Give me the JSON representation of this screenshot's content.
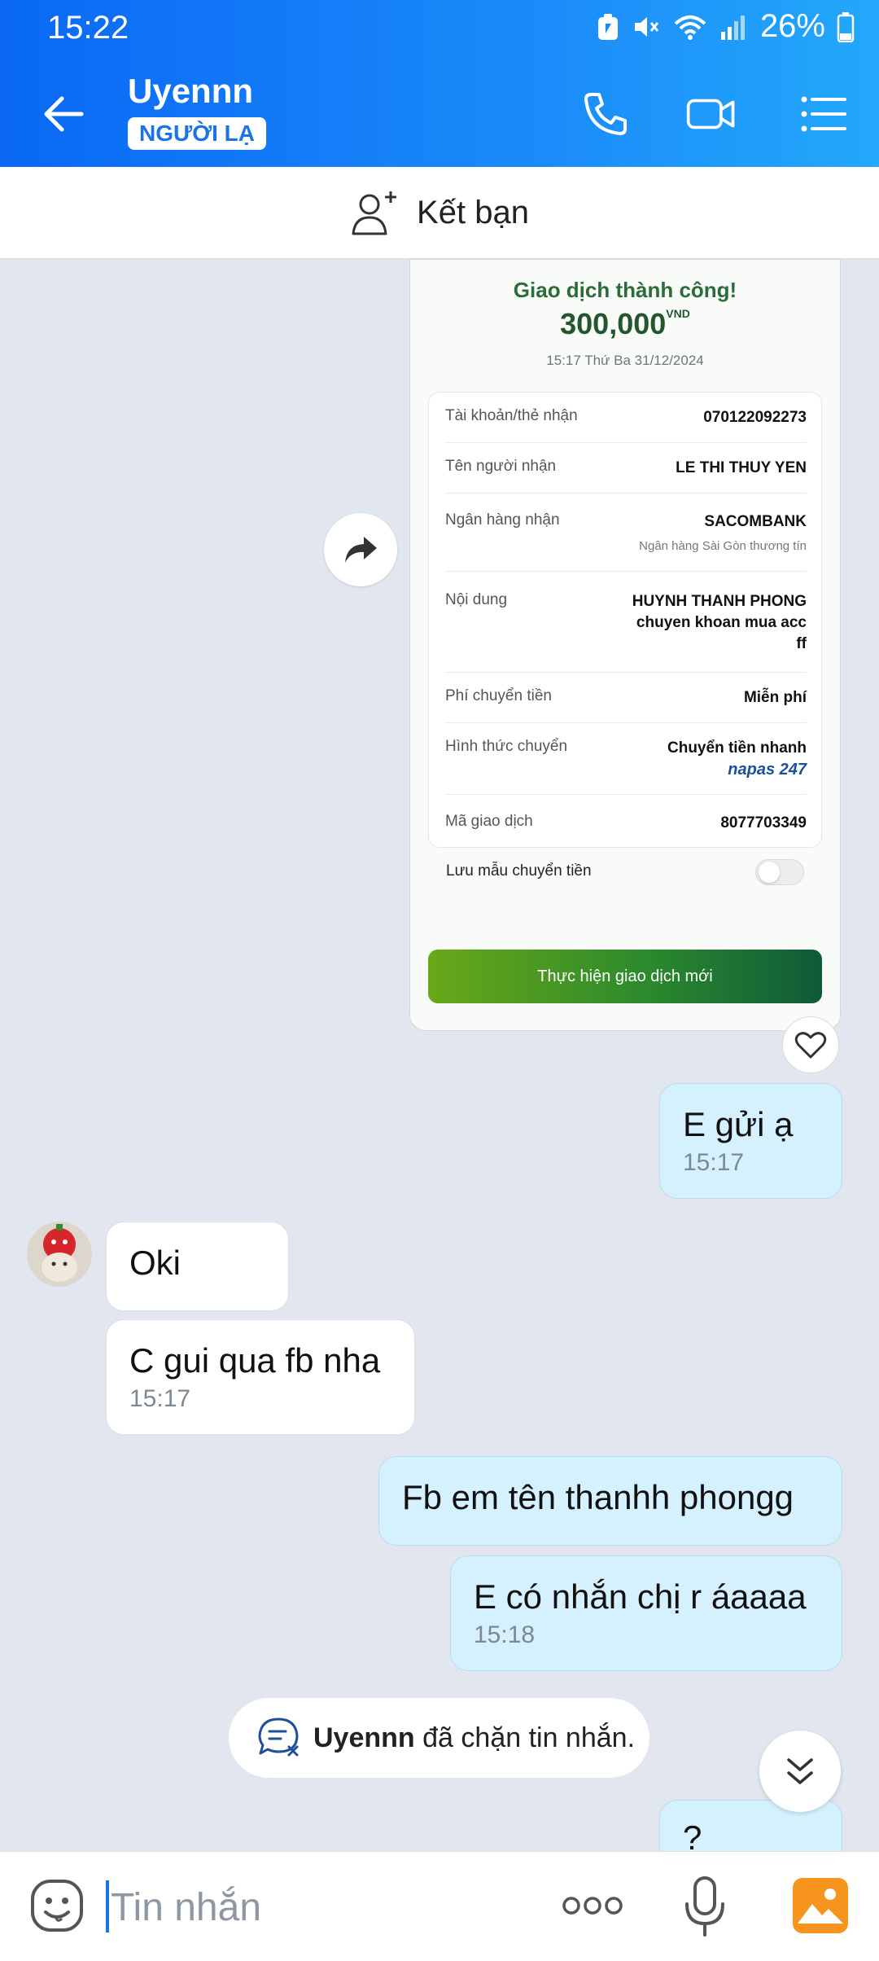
{
  "status_bar": {
    "time": "15:22",
    "battery": "26%"
  },
  "header": {
    "contact_name": "Uyennn",
    "stranger_badge": "NGƯỜI LẠ"
  },
  "friend_bar": {
    "label": "Kết bạn"
  },
  "receipt": {
    "title": "Giao dịch thành công!",
    "amount": "300,000",
    "currency": "VND",
    "datetime": "15:17 Thứ Ba 31/12/2024",
    "rows": [
      {
        "key": "Tài khoản/thẻ nhận",
        "value": "070122092273"
      },
      {
        "key": "Tên người nhận",
        "value": "LE THI THUY YEN"
      },
      {
        "key": "Ngân hàng nhận",
        "value": "SACOMBANK",
        "sub": "Ngân hàng Sài Gòn thương tín"
      },
      {
        "key": "Nội dung",
        "value_lines": [
          "HUYNH THANH PHONG",
          "chuyen khoan mua acc",
          "ff"
        ]
      },
      {
        "key": "Phí chuyển tiền",
        "value": "Miễn phí"
      },
      {
        "key": "Hình thức chuyển",
        "value": "Chuyển tiền nhanh",
        "logo": "napas 247"
      },
      {
        "key": "Mã giao dịch",
        "value": "8077703349"
      }
    ],
    "save_template": "Lưu mẫu chuyển tiền",
    "new_tx_button": "Thực hiện giao dịch mới"
  },
  "messages": [
    {
      "from": "me",
      "text": "E gửi ạ",
      "time": "15:17"
    },
    {
      "from": "them",
      "text": "Oki"
    },
    {
      "from": "them",
      "text": "C gui qua fb nha",
      "time": "15:17"
    },
    {
      "from": "me",
      "text": "Fb em tên thanhh phongg"
    },
    {
      "from": "me",
      "text": "E có nhắn chị r áaaaa",
      "time": "15:18"
    },
    {
      "from": "me",
      "text": "?"
    }
  ],
  "blocked_notice": {
    "name": "Uyennn",
    "text": "đã chặn tin nhắn."
  },
  "input": {
    "placeholder": "Tin nhắn"
  },
  "colors": {
    "header_start": "#0a68f5",
    "header_end": "#23a8fb",
    "my_bubble": "#d5f1ff",
    "chat_bg": "#e2e7ef",
    "accent": "#1a73e8"
  }
}
